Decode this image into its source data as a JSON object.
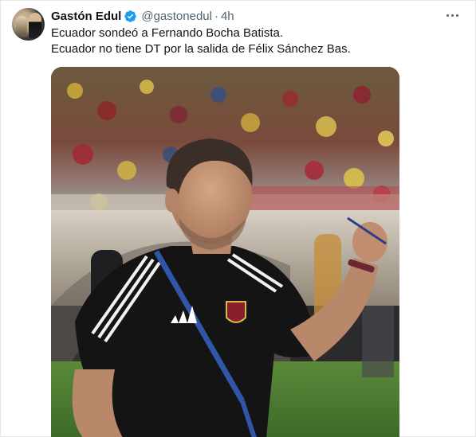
{
  "author": {
    "name": "Gastón Edul",
    "handle": "@gastonedul",
    "separator": "·",
    "time": "4h",
    "verified": true
  },
  "tweet": {
    "lines": [
      "Ecuador sondeó a Fernando Bocha Batista.",
      "Ecuador no tiene DT por la salida de Félix Sánchez Bas."
    ]
  },
  "colors": {
    "text": "#0f1419",
    "secondary": "#536471",
    "verified": "#1d9bf0"
  },
  "icons": {
    "verified": "verified-badge-icon",
    "more": "more-options-icon"
  }
}
